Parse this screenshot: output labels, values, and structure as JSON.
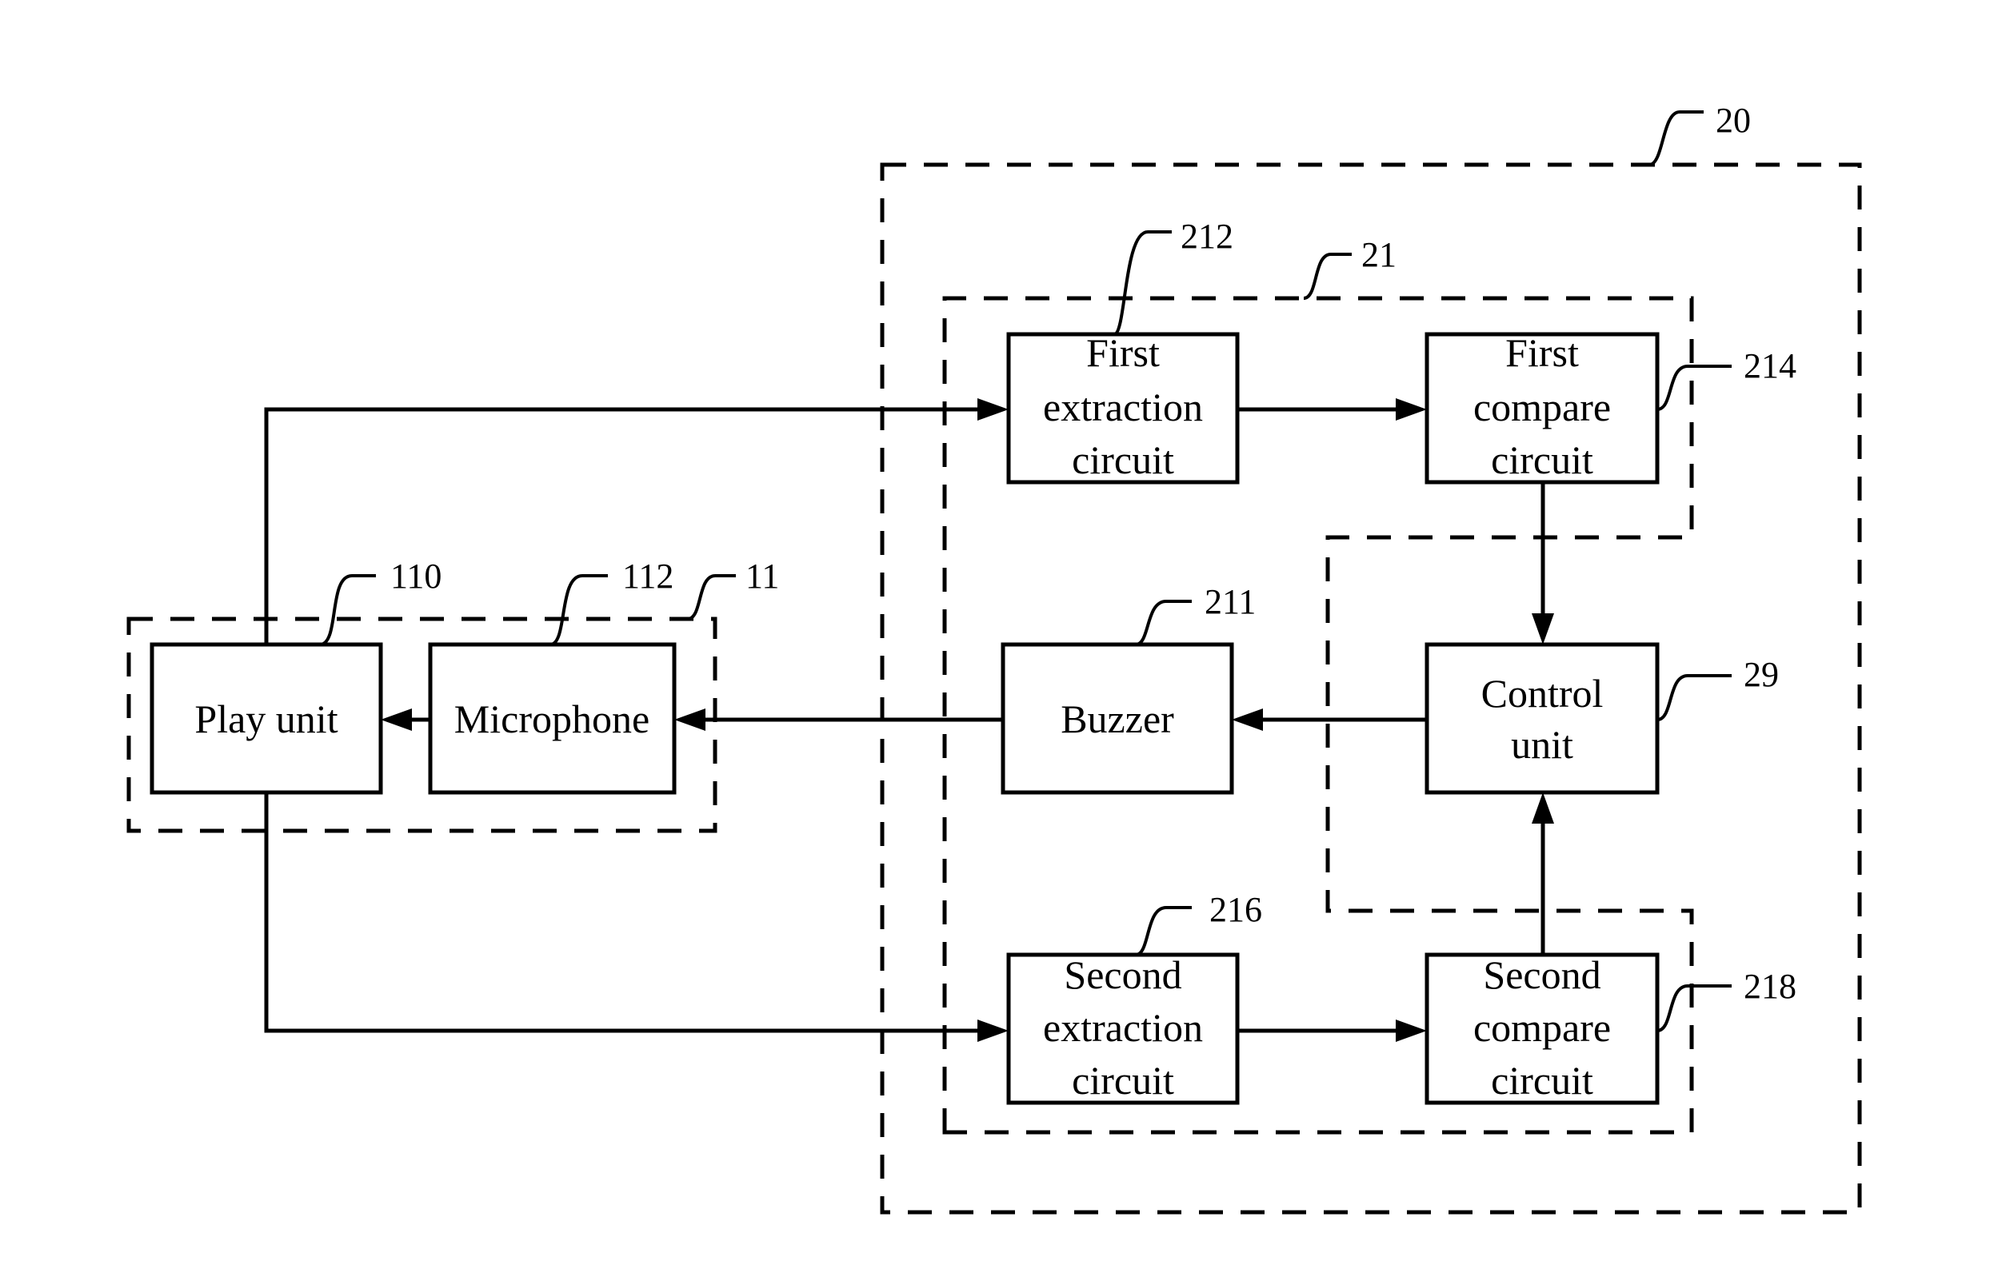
{
  "diagram": {
    "groups": [
      {
        "id": "20",
        "ref": "20"
      },
      {
        "id": "21",
        "ref": "21"
      },
      {
        "id": "11",
        "ref": "11"
      }
    ],
    "blocks": [
      {
        "id": "play_unit",
        "ref": "110",
        "lines": [
          "Play unit"
        ]
      },
      {
        "id": "microphone",
        "ref": "112",
        "lines": [
          "Microphone"
        ]
      },
      {
        "id": "buzzer",
        "ref": "211",
        "lines": [
          "Buzzer"
        ]
      },
      {
        "id": "control_unit",
        "ref": "29",
        "lines": [
          "Control",
          "unit"
        ]
      },
      {
        "id": "first_extraction",
        "ref": "212",
        "lines": [
          "First",
          "extraction",
          "circuit"
        ]
      },
      {
        "id": "first_compare",
        "ref": "214",
        "lines": [
          "First",
          "compare",
          "circuit"
        ]
      },
      {
        "id": "second_extraction",
        "ref": "216",
        "lines": [
          "Second",
          "extraction",
          "circuit"
        ]
      },
      {
        "id": "second_compare",
        "ref": "218",
        "lines": [
          "Second",
          "compare",
          "circuit"
        ]
      }
    ],
    "connections": [
      {
        "from": "play_unit",
        "to": "first_extraction"
      },
      {
        "from": "play_unit",
        "to": "second_extraction"
      },
      {
        "from": "first_extraction",
        "to": "first_compare"
      },
      {
        "from": "second_extraction",
        "to": "second_compare"
      },
      {
        "from": "first_compare",
        "to": "control_unit"
      },
      {
        "from": "second_compare",
        "to": "control_unit"
      },
      {
        "from": "control_unit",
        "to": "buzzer"
      },
      {
        "from": "buzzer",
        "to": "microphone"
      },
      {
        "from": "microphone",
        "to": "play_unit"
      }
    ]
  }
}
